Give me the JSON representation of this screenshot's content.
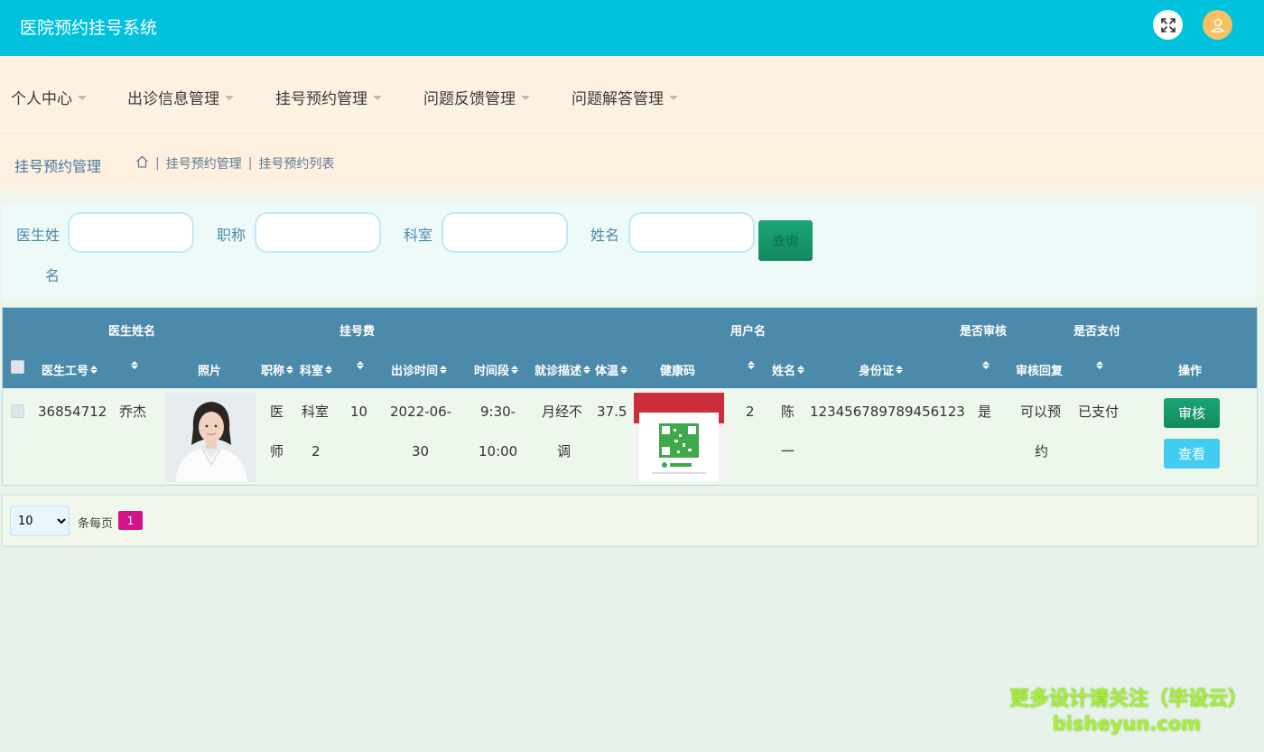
{
  "app": {
    "title": "医院预约挂号系统"
  },
  "menu": [
    {
      "label": "个人中心"
    },
    {
      "label": "出诊信息管理"
    },
    {
      "label": "挂号预约管理"
    },
    {
      "label": "问题反馈管理"
    },
    {
      "label": "问题解答管理"
    }
  ],
  "breadcrumb": {
    "title": "挂号预约管理",
    "items": [
      "挂号预约管理",
      "挂号预约列表"
    ]
  },
  "search": {
    "fields": [
      {
        "label_line1": "医生姓",
        "label_line2": "名",
        "value": ""
      },
      {
        "label": "职称",
        "value": ""
      },
      {
        "label": "科室",
        "value": ""
      },
      {
        "label": "姓名",
        "value": ""
      }
    ],
    "button": "查询"
  },
  "table": {
    "group_headers": [
      "医生姓名",
      "挂号费",
      "用户名",
      "是否审核",
      "是否支付"
    ],
    "columns": [
      "医生工号",
      "照片",
      "职称",
      "科室",
      "出诊时间",
      "时间段",
      "就诊描述",
      "体温",
      "健康码",
      "姓名",
      "身份证",
      "审核回复",
      "操作"
    ],
    "rows": [
      {
        "doctor_id": "36854712",
        "doctor_name": "乔杰",
        "title_l1": "医",
        "title_l2": "师",
        "dept_l1": "科室",
        "dept_l2": "2",
        "fee": "10",
        "date_l1": "2022-06-",
        "date_l2": "30",
        "period_l1": "9:30-",
        "period_l2": "10:00",
        "desc_l1": "月经不",
        "desc_l2": "调",
        "temp": "37.5",
        "username": "2",
        "name_l1": "陈",
        "name_l2": "一",
        "id_card": "123456789789456123",
        "audited": "是",
        "reply_l1": "可以预",
        "reply_l2": "约",
        "paid": "已支付",
        "actions": {
          "audit": "审核",
          "view": "查看"
        }
      }
    ]
  },
  "pagination": {
    "page_size": "10",
    "per_page_label": "条每页",
    "current_page": "1"
  },
  "watermark": {
    "line1": "更多设计请关注（毕设云）",
    "line2": "bisheyun.com"
  },
  "colors": {
    "topbar": "#00c2dd",
    "table_header": "#4c8aab",
    "primary": "#1aa574",
    "info": "#42cdf0",
    "page_active": "#d0138a"
  }
}
